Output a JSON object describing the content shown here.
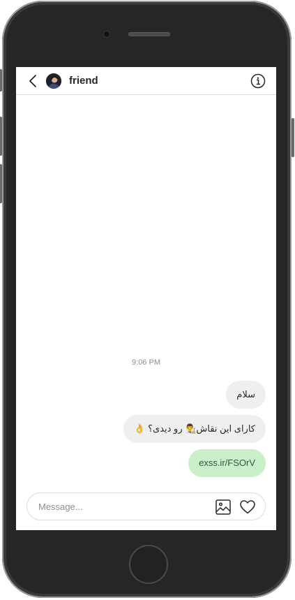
{
  "header": {
    "contact_name": "friend"
  },
  "conversation": {
    "timestamp": "9:06 PM",
    "messages": [
      {
        "text": "سلام",
        "type": "received"
      },
      {
        "text": "کارای این نقاش👨‍🎨 رو دیدی؟ 👌",
        "type": "received"
      },
      {
        "text": "exss.ir/FSOrV",
        "type": "link"
      }
    ]
  },
  "composer": {
    "placeholder": "Message..."
  },
  "colors": {
    "link_bubble": "#c9f0c9",
    "received_bubble": "#efefef",
    "phone_body": "#262626"
  },
  "icons": [
    "chevron-left-icon",
    "info-icon",
    "image-icon",
    "heart-icon"
  ]
}
